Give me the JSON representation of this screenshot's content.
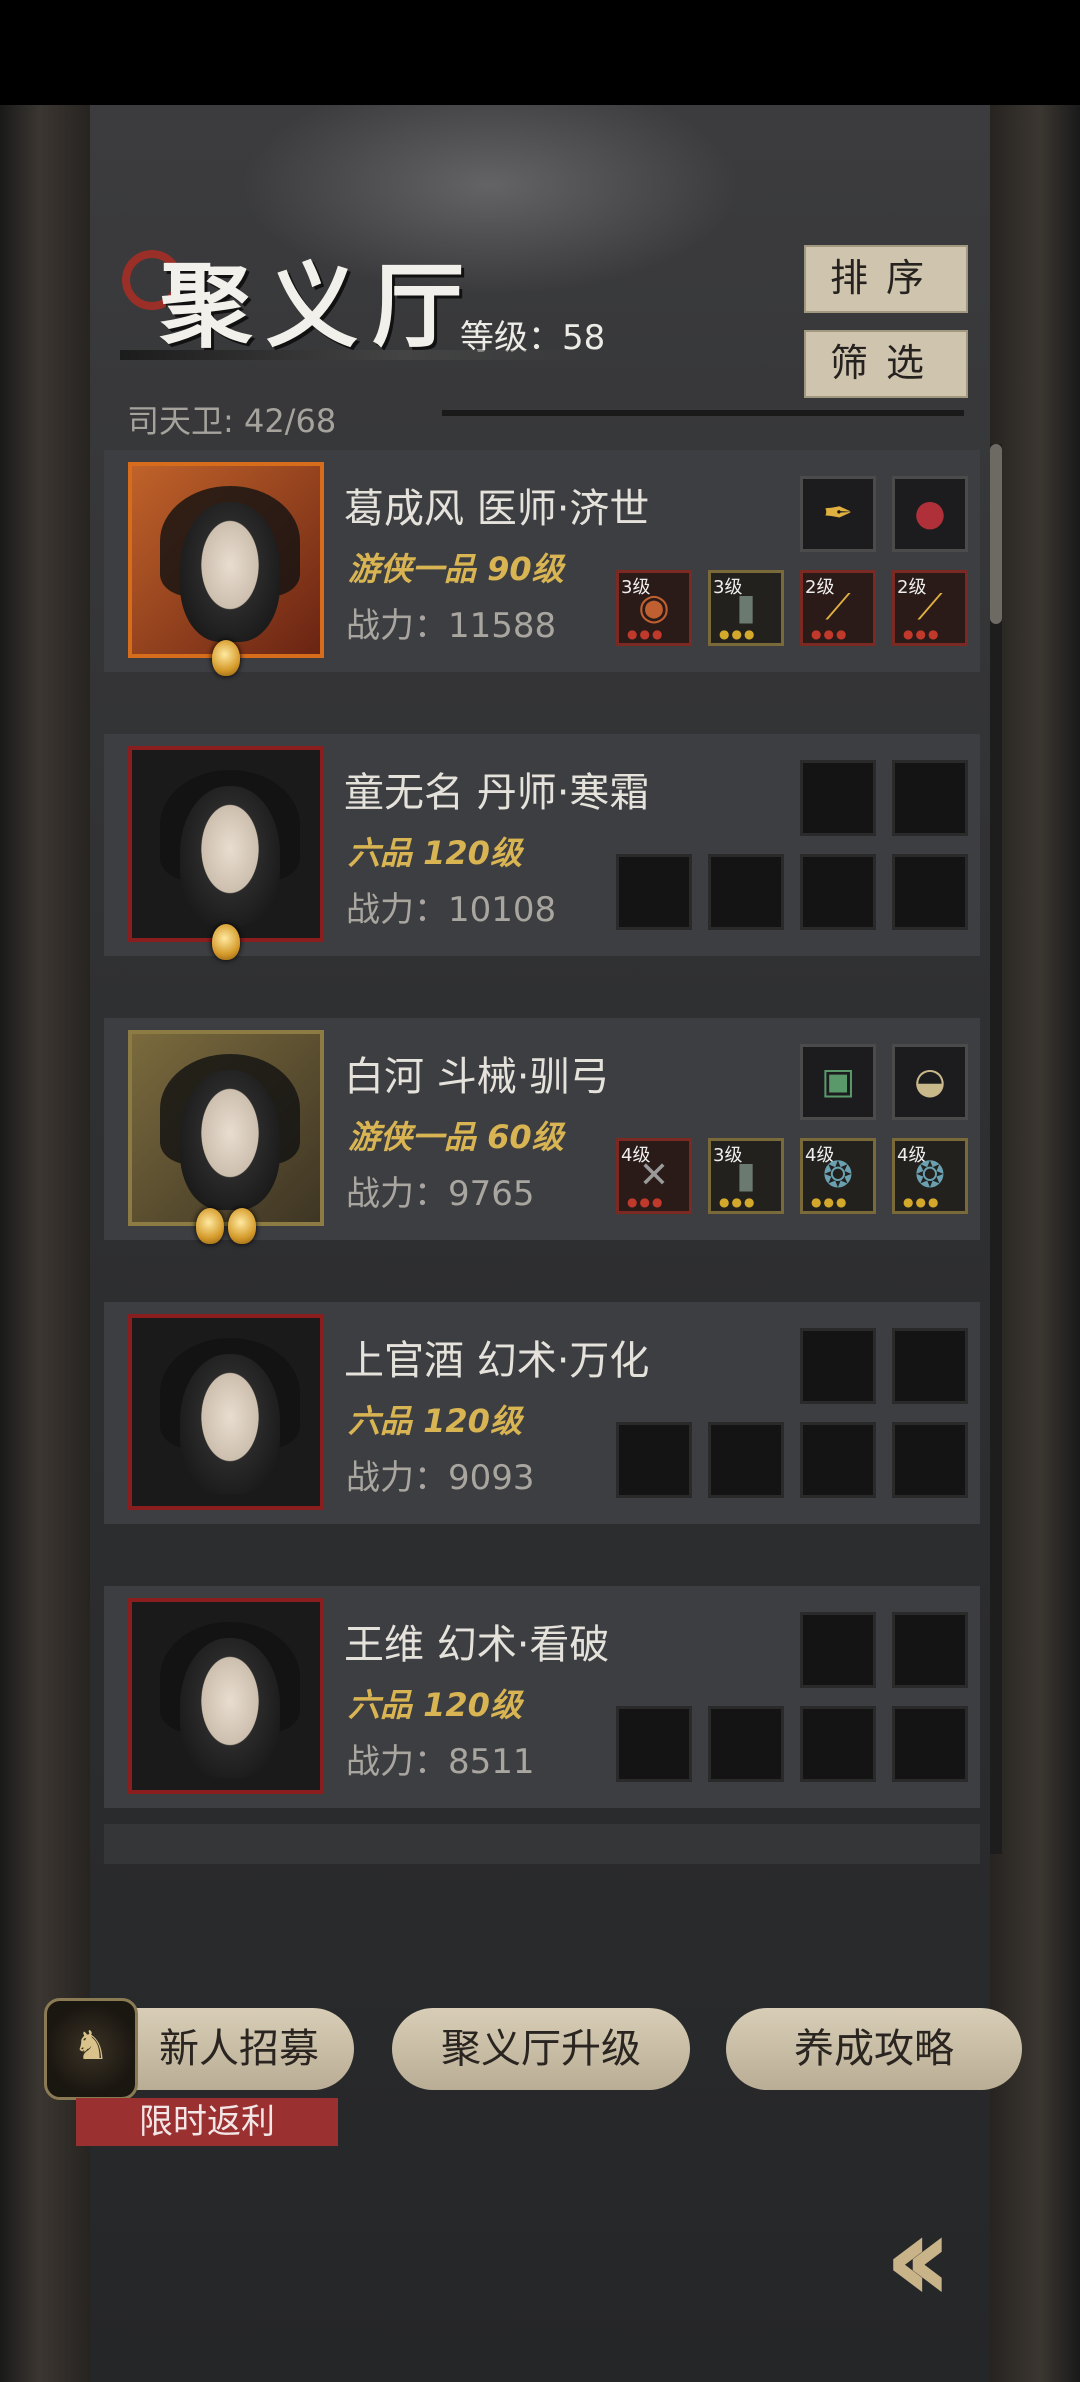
{
  "header": {
    "title": "聚义厅",
    "level_label": "等级：58",
    "sort_label": "排序",
    "filter_label": "筛选",
    "capacity_label": "司天卫: 42/68"
  },
  "heroes": [
    {
      "name": "葛成风  医师·济世",
      "rank": "游侠一品 90级",
      "power": "战力：11588",
      "top_slots": [
        "golden-brush-icon",
        "red-gem-icon"
      ],
      "bottom_slots": [
        {
          "level": "3级",
          "icon": "orb-icon"
        },
        {
          "level": "3级",
          "icon": "armor-icon"
        },
        {
          "level": "2级",
          "icon": "golden-brush-icon"
        },
        {
          "level": "2级",
          "icon": "golden-brush-icon"
        }
      ]
    },
    {
      "name": "童无名  丹师·寒霜",
      "rank": "六品  120级",
      "power": "战力：10108",
      "top_slots": [
        "empty",
        "empty"
      ],
      "bottom_slots": [
        "empty",
        "empty",
        "empty",
        "empty"
      ]
    },
    {
      "name": "白河  斗械·驯弓",
      "rank": "游侠一品 60级",
      "power": "战力：9765",
      "top_slots": [
        "jade-token-icon",
        "fan-icon"
      ],
      "bottom_slots": [
        {
          "level": "4级",
          "icon": "crossbow-icon"
        },
        {
          "level": "3级",
          "icon": "armor-icon"
        },
        {
          "level": "4级",
          "icon": "owl-icon"
        },
        {
          "level": "4级",
          "icon": "owl-icon"
        }
      ]
    },
    {
      "name": "上官酒  幻术·万化",
      "rank": "六品  120级",
      "power": "战力：9093",
      "top_slots": [
        "empty",
        "empty"
      ],
      "bottom_slots": [
        "empty",
        "empty",
        "empty",
        "empty"
      ]
    },
    {
      "name": "王维  幻术·看破",
      "rank": "六品  120级",
      "power": "战力：8511",
      "top_slots": [
        "empty",
        "empty"
      ],
      "bottom_slots": [
        "empty",
        "empty",
        "empty",
        "empty"
      ]
    }
  ],
  "footer": {
    "recruit_label": "新人招募",
    "upgrade_label": "聚义厅升级",
    "guide_label": "养成攻略",
    "promo_label": "限时返利"
  },
  "colors": {
    "accent_gold": "#d9b453",
    "button_beige": "#cfc4ae",
    "promo_red": "#9a3030"
  }
}
